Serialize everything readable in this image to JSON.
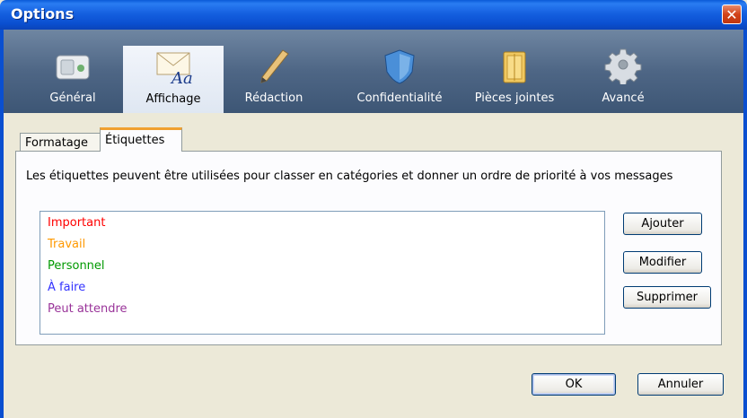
{
  "window": {
    "title": "Options",
    "close_icon": "close-icon"
  },
  "toolbar": {
    "items": [
      {
        "label": "Général",
        "icon": "general-icon",
        "selected": false
      },
      {
        "label": "Affichage",
        "icon": "display-icon",
        "selected": true
      },
      {
        "label": "Rédaction",
        "icon": "pen-icon",
        "selected": false
      },
      {
        "label": "Confidentialité",
        "icon": "shield-icon",
        "selected": false
      },
      {
        "label": "Pièces jointes",
        "icon": "folder-icon",
        "selected": false
      },
      {
        "label": "Avancé",
        "icon": "gear-icon",
        "selected": false
      }
    ]
  },
  "tabs": [
    {
      "label": "Formatage",
      "active": false
    },
    {
      "label": "Étiquettes",
      "active": true
    }
  ],
  "panel": {
    "description": "Les étiquettes peuvent être utilisées pour classer en catégories et donner un ordre de priorité à vos messages",
    "labels": [
      {
        "text": "Important",
        "color": "#ff0000"
      },
      {
        "text": "Travail",
        "color": "#ff9900"
      },
      {
        "text": "Personnel",
        "color": "#009900"
      },
      {
        "text": "À faire",
        "color": "#3333ff"
      },
      {
        "text": "Peut attendre",
        "color": "#993399"
      }
    ],
    "buttons": {
      "add": "Ajouter",
      "modify": "Modifier",
      "delete": "Supprimer"
    }
  },
  "footer": {
    "ok": "OK",
    "cancel": "Annuler"
  }
}
